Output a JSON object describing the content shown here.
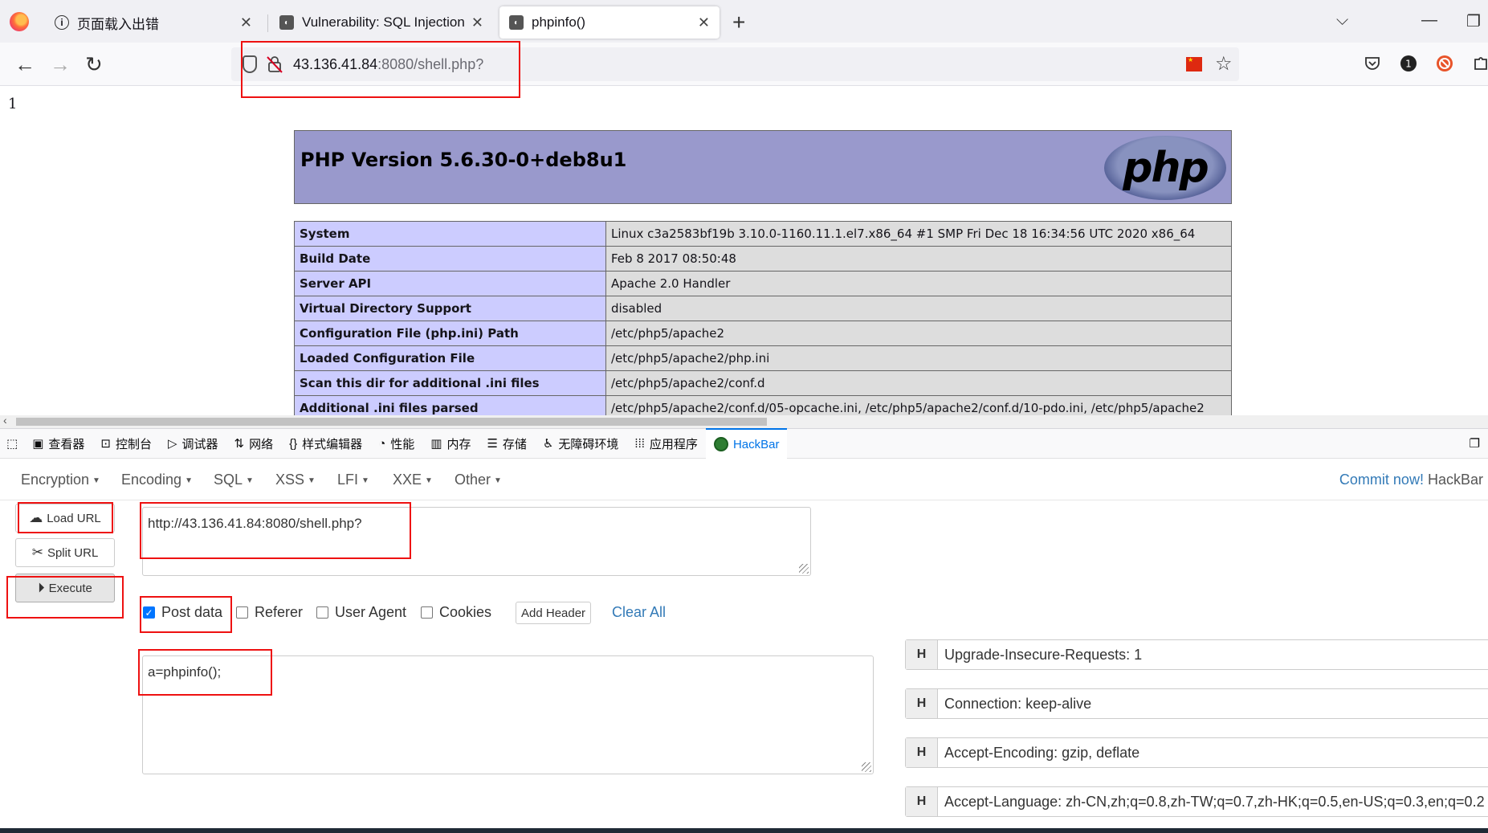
{
  "tabs": [
    {
      "title": "页面载入出错",
      "icon": "info-icon"
    },
    {
      "title": "Vulnerability: SQL Injection :: ",
      "icon": "dvwa-icon"
    },
    {
      "title": "phpinfo()",
      "icon": "php-page-icon",
      "active": true
    }
  ],
  "address": {
    "host": "43.136.41.84",
    "path": ":8080/shell.php?"
  },
  "page": {
    "echo_output": "1",
    "php_version_title": "PHP Version 5.6.30-0+deb8u1",
    "php_logo_text": "php",
    "info_rows": [
      {
        "key": "System",
        "value": "Linux c3a2583bf19b 3.10.0-1160.11.1.el7.x86_64 #1 SMP Fri Dec 18 16:34:56 UTC 2020 x86_64"
      },
      {
        "key": "Build Date",
        "value": "Feb 8 2017 08:50:48"
      },
      {
        "key": "Server API",
        "value": "Apache 2.0 Handler"
      },
      {
        "key": "Virtual Directory Support",
        "value": "disabled"
      },
      {
        "key": "Configuration File (php.ini) Path",
        "value": "/etc/php5/apache2"
      },
      {
        "key": "Loaded Configuration File",
        "value": "/etc/php5/apache2/php.ini"
      },
      {
        "key": "Scan this dir for additional .ini files",
        "value": "/etc/php5/apache2/conf.d"
      },
      {
        "key": "Additional .ini files parsed",
        "value": "/etc/php5/apache2/conf.d/05-opcache.ini, /etc/php5/apache2/conf.d/10-pdo.ini, /etc/php5/apache2"
      }
    ]
  },
  "devtools": {
    "tabs": [
      {
        "label": "查看器",
        "icon": "inspector-icon"
      },
      {
        "label": "控制台",
        "icon": "console-icon"
      },
      {
        "label": "调试器",
        "icon": "debugger-icon"
      },
      {
        "label": "网络",
        "icon": "network-icon"
      },
      {
        "label": "样式编辑器",
        "icon": "style-editor-icon"
      },
      {
        "label": "性能",
        "icon": "performance-icon"
      },
      {
        "label": "内存",
        "icon": "memory-icon"
      },
      {
        "label": "存储",
        "icon": "storage-icon"
      },
      {
        "label": "无障碍环境",
        "icon": "accessibility-icon"
      },
      {
        "label": "应用程序",
        "icon": "application-icon"
      },
      {
        "label": "HackBar",
        "icon": "hackbar-icon",
        "active": true
      }
    ]
  },
  "hackbar": {
    "menu": [
      "Encryption",
      "Encoding",
      "SQL",
      "XSS",
      "LFI",
      "XXE",
      "Other"
    ],
    "commit_link": "Commit now!",
    "commit_brand": "HackBar",
    "buttons": {
      "load_url": "Load URL",
      "split_url": "Split URL",
      "execute": "Execute"
    },
    "url_value": "http://43.136.41.84:8080/shell.php?",
    "options": {
      "post_data": "Post data",
      "referer": "Referer",
      "user_agent": "User Agent",
      "cookies": "Cookies"
    },
    "post_data_checked": true,
    "add_header": "Add Header",
    "clear_all": "Clear All",
    "post_body": "a=phpinfo();",
    "header_badge": "H",
    "headers": [
      "Upgrade-Insecure-Requests: 1",
      "Connection: keep-alive",
      "Accept-Encoding: gzip, deflate",
      "Accept-Language: zh-CN,zh;q=0.8,zh-TW;q=0.7,zh-HK;q=0.5,en-US;q=0.3,en;q=0.2"
    ]
  },
  "colors": {
    "php_header": "#9999cc",
    "key_cell": "#ccccff",
    "value_cell": "#dddddd",
    "highlight": "#ee1111",
    "link": "#337ab7"
  }
}
